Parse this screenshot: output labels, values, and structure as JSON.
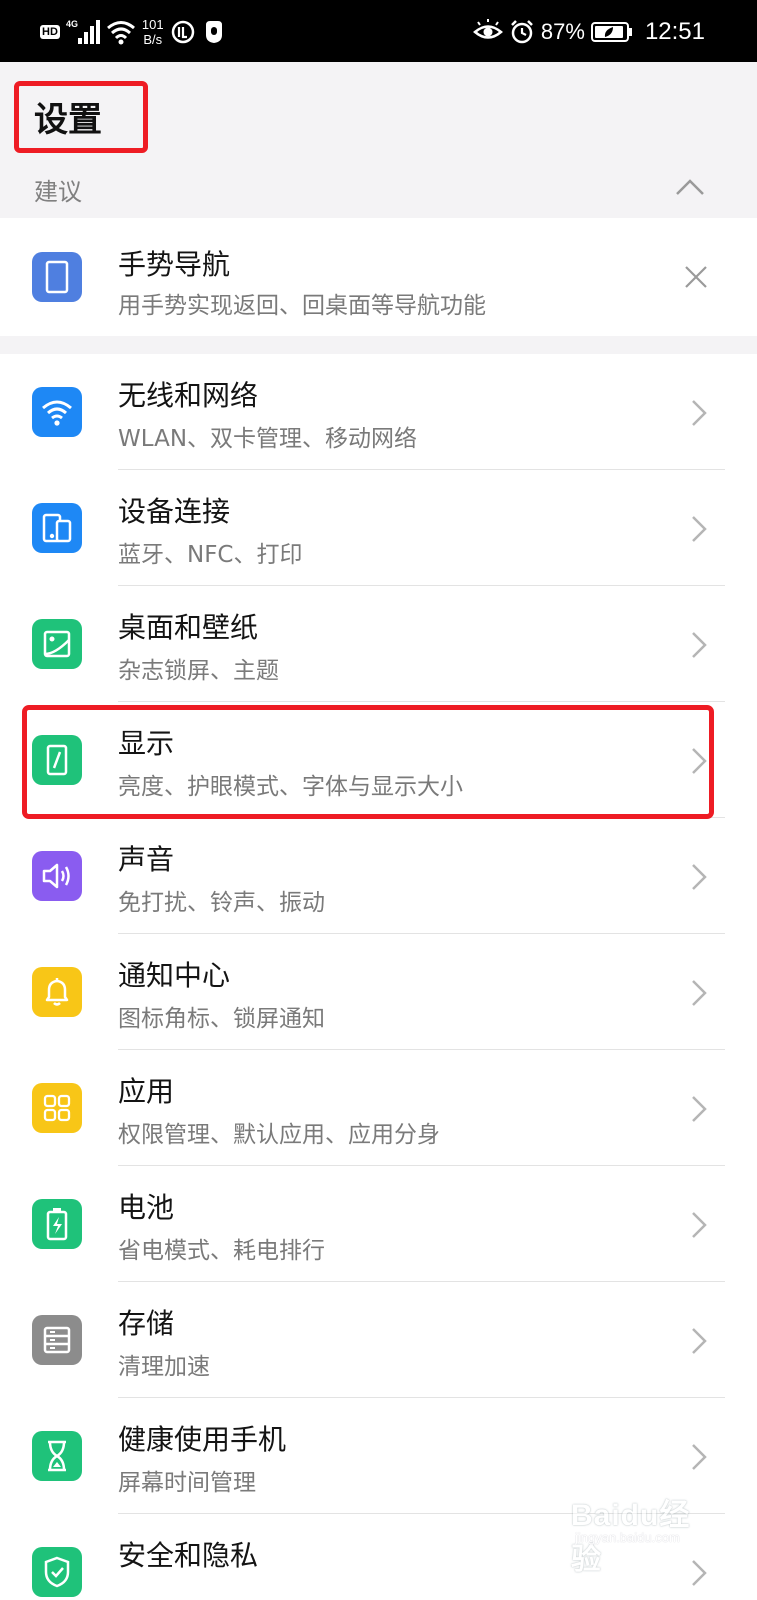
{
  "status_bar": {
    "hd_label": "HD",
    "net_type": "4G",
    "net_rate_value": "101",
    "net_rate_unit": "B/s",
    "battery": "87%",
    "time": "12:51"
  },
  "header": {
    "title": "设置"
  },
  "suggestions": {
    "label": "建议",
    "item": {
      "title": "手势导航",
      "subtitle": "用手势实现返回、回桌面等导航功能",
      "icon": "phone-outline-icon",
      "color": "#4f7fe0"
    }
  },
  "settings": [
    {
      "title": "无线和网络",
      "subtitle": "WLAN、双卡管理、移动网络",
      "icon": "wifi-icon",
      "color": "#1e88f5"
    },
    {
      "title": "设备连接",
      "subtitle": "蓝牙、NFC、打印",
      "icon": "device-connection-icon",
      "color": "#1e88f5"
    },
    {
      "title": "桌面和壁纸",
      "subtitle": "杂志锁屏、主题",
      "icon": "wallpaper-icon",
      "color": "#1fc27a"
    },
    {
      "title": "显示",
      "subtitle": "亮度、护眼模式、字体与显示大小",
      "icon": "display-icon",
      "color": "#1fc27a"
    },
    {
      "title": "声音",
      "subtitle": "免打扰、铃声、振动",
      "icon": "speaker-icon",
      "color": "#8a5cf0"
    },
    {
      "title": "通知中心",
      "subtitle": "图标角标、锁屏通知",
      "icon": "bell-icon",
      "color": "#f8c617"
    },
    {
      "title": "应用",
      "subtitle": "权限管理、默认应用、应用分身",
      "icon": "apps-grid-icon",
      "color": "#f8c617"
    },
    {
      "title": "电池",
      "subtitle": "省电模式、耗电排行",
      "icon": "battery-icon",
      "color": "#1fc27a"
    },
    {
      "title": "存储",
      "subtitle": "清理加速",
      "icon": "storage-icon",
      "color": "#8c8c8c"
    },
    {
      "title": "健康使用手机",
      "subtitle": "屏幕时间管理",
      "icon": "hourglass-icon",
      "color": "#1fc27a"
    },
    {
      "title": "安全和隐私",
      "subtitle": "",
      "icon": "shield-icon",
      "color": "#1fc27a"
    }
  ],
  "watermark": {
    "brand": "Baidu经验",
    "domain": "jingyan.baidu.com"
  },
  "accent_colors": {
    "highlight": "#ee1c24",
    "section_bg": "#f4f3f5"
  }
}
